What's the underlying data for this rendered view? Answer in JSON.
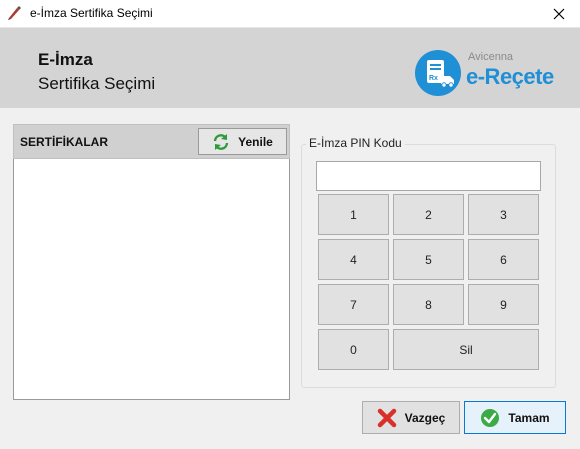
{
  "window": {
    "title": "e-İmza Sertifika Seçimi"
  },
  "header": {
    "title": "E-İmza",
    "subtitle": "Sertifika Seçimi"
  },
  "logo": {
    "sub": "Avicenna",
    "main": "e-Reçete"
  },
  "certificates": {
    "header_label": "SERTİFİKALAR",
    "refresh_label": "Yenile"
  },
  "pin": {
    "group_label": "E-İmza PIN Kodu",
    "value": "",
    "keys": [
      "1",
      "2",
      "3",
      "4",
      "5",
      "6",
      "7",
      "8",
      "9",
      "0",
      "Sil"
    ]
  },
  "footer": {
    "cancel_label": "Vazgeç",
    "ok_label": "Tamam"
  }
}
